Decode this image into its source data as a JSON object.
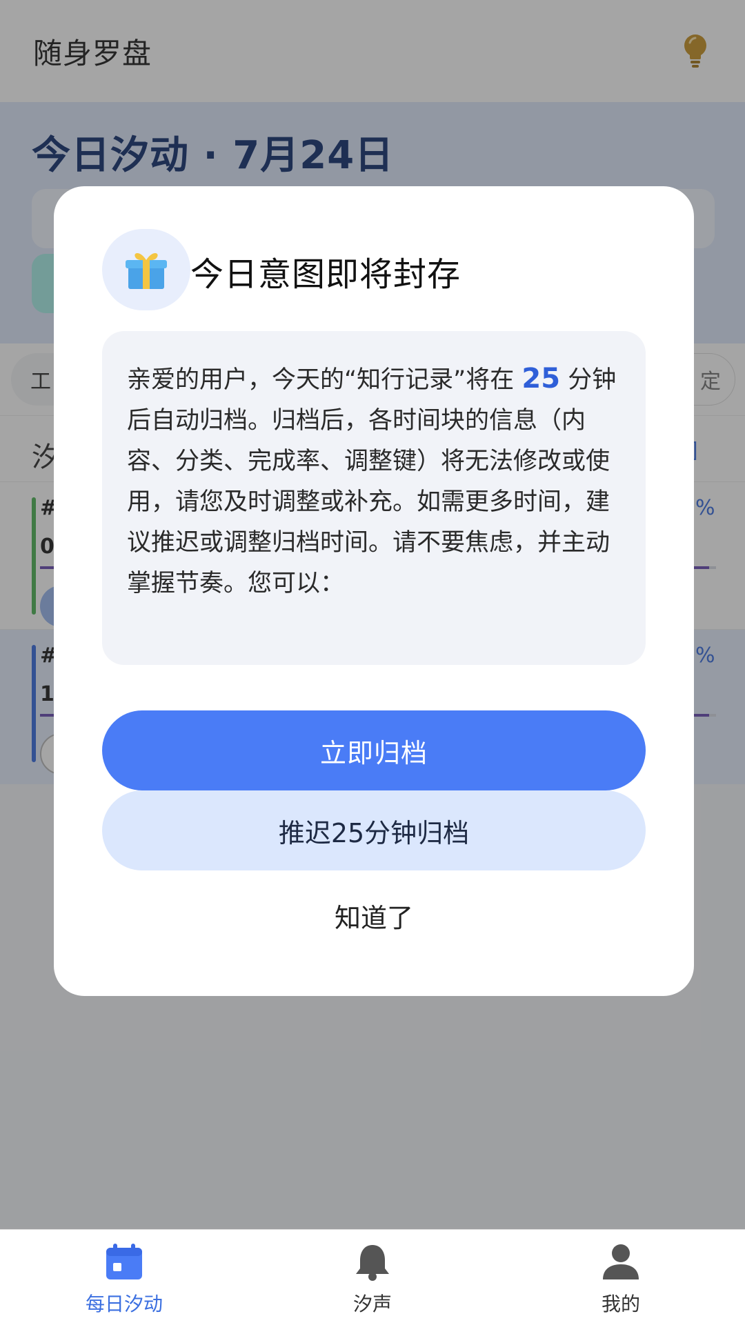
{
  "app": {
    "title": "随身罗盘"
  },
  "header": {
    "date_title": "今日汐动 · 7月24日"
  },
  "filters": {
    "left_chip": "工",
    "right_chip": "定"
  },
  "section": {
    "title": "汐",
    "link": "]"
  },
  "blocks": [
    {
      "hash": "#",
      "time": "0(",
      "percent_label": "%",
      "progress": 0.99
    },
    {
      "hash": "#",
      "time": "1!",
      "percent_label": "%",
      "progress": 0.99
    }
  ],
  "modal": {
    "icon": "gift-icon",
    "title": "今日意图即将封存",
    "message": {
      "part1": "亲爱的用户，今天的“知行记录”将在 ",
      "minutes": "25",
      "part2": " 分钟后自动归档。归档后，各时间块的信息（内容、分类、完成率、调整键）将无法修改或使用，请您及时调整或补充。如需更多时间，建议推迟或调整归档时间。请不要焦虑，并主动掌握节奏。您可以："
    },
    "primary_button": "立即归档",
    "secondary_button": "推迟25分钟归档",
    "dismiss_button": "知道了"
  },
  "nav": {
    "items": [
      {
        "label": "每日汐动",
        "icon": "calendar-icon",
        "active": true
      },
      {
        "label": "汐声",
        "icon": "bell-icon",
        "active": false
      },
      {
        "label": "我的",
        "icon": "user-icon",
        "active": false
      }
    ]
  },
  "colors": {
    "primary": "#4a7cf6",
    "secondary": "#dbe7fd",
    "title_blue": "#173473",
    "accent_gold": "#c9952a"
  }
}
